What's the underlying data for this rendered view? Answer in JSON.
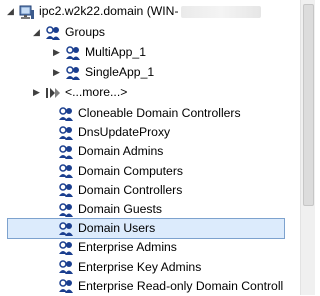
{
  "tree": {
    "root": {
      "label": "ipc2.w2k22.domain (WIN-",
      "label_suffix": ""
    },
    "groups_label": "Groups",
    "group_children": [
      {
        "label": "MultiApp_1"
      },
      {
        "label": "SingleApp_1"
      }
    ],
    "more_label": "<...more...>",
    "items": [
      {
        "label": "Cloneable Domain Controllers"
      },
      {
        "label": "DnsUpdateProxy"
      },
      {
        "label": "Domain Admins"
      },
      {
        "label": "Domain Computers"
      },
      {
        "label": "Domain Controllers"
      },
      {
        "label": "Domain Guests"
      },
      {
        "label": "Domain Users"
      },
      {
        "label": "Enterprise Admins"
      },
      {
        "label": "Enterprise Key Admins"
      },
      {
        "label": "Enterprise Read-only Domain Controll"
      }
    ],
    "selected_item": "Domain Users"
  },
  "colors": {
    "selection_bg": "#dcebfc",
    "selection_border": "#7da2ce",
    "group_icon_blue": "#1b3f8f"
  },
  "icons": {
    "server": "server-icon",
    "group": "group-icon",
    "more": "more-icon",
    "expanded": "expanded-arrow-icon",
    "collapsed": "collapsed-arrow-icon"
  }
}
